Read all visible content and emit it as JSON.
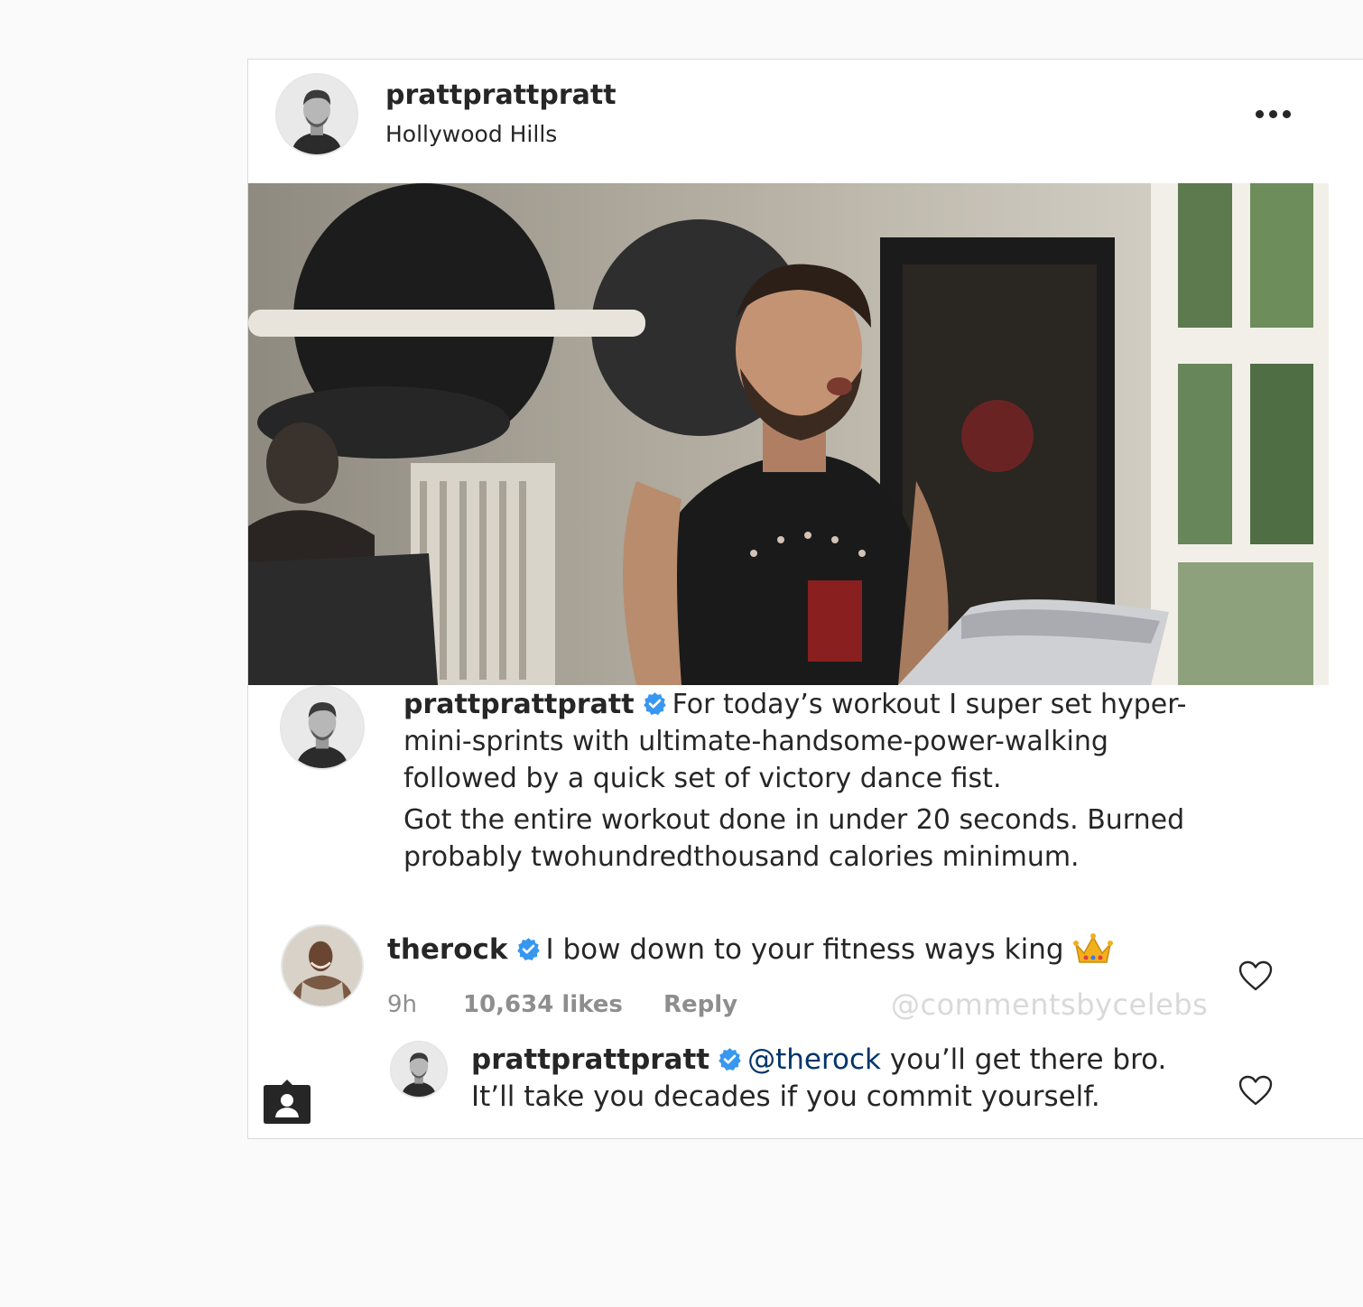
{
  "post": {
    "username": "prattprattpratt",
    "location": "Hollywood Hills",
    "more_icon": "more-options-icon",
    "media_description_icon": "video-frame"
  },
  "caption": {
    "username": "prattprattpratt",
    "line_1": "For today’s workout I super set hyper-mini-sprints with ultimate-handsome-power-walking followed by a quick set of victory dance fist.",
    "line_2": "Got the entire workout done in under 20 seconds. Burned probably twohundredthousand calories minimum."
  },
  "comments": [
    {
      "username": "therock",
      "text": "I bow down to your fitness ways king",
      "emoji_icon": "crown-emoji",
      "time": "9h",
      "likes": "10,634 likes",
      "reply_label": "Reply"
    },
    {
      "username": "prattprattpratt",
      "mention": "@therock",
      "text": " you’ll get there bro. It’ll take you decades if you commit yourself."
    }
  ],
  "watermark": "@commentsbycelebs",
  "colors": {
    "verified_blue": "#3897f0",
    "text": "#262626",
    "meta_gray": "#8e8e8e",
    "mention": "#003569"
  }
}
